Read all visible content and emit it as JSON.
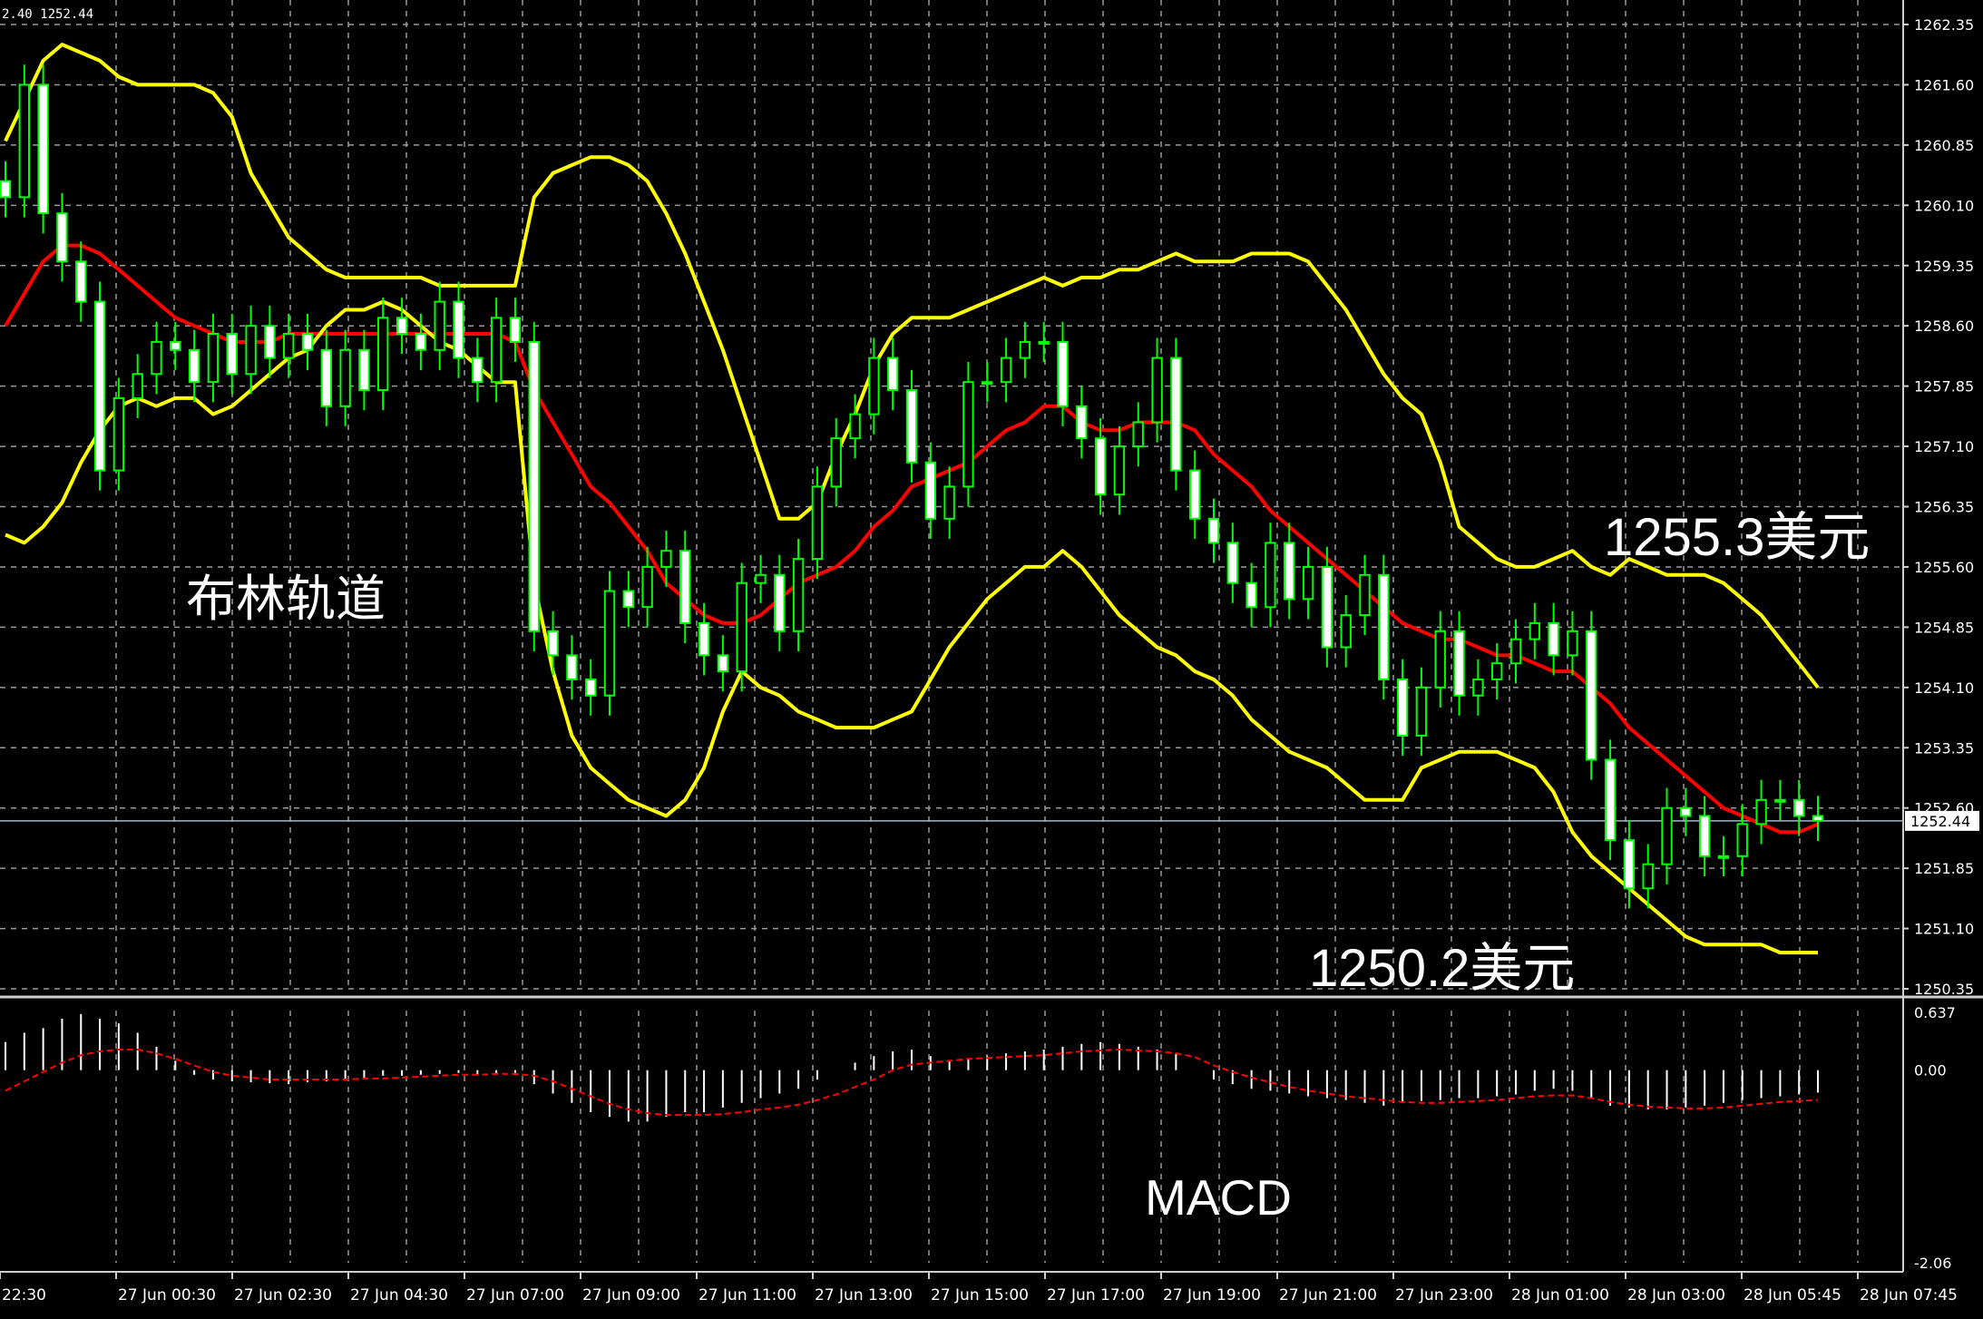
{
  "header": {
    "text": "2.40 1252.44"
  },
  "annotations": {
    "bollinger": "布林轨道",
    "upper_price": "1255.3美元",
    "lower_price": "1250.2美元",
    "macd": "MACD"
  },
  "colors": {
    "background": "#000000",
    "grid": "#9a9a9a",
    "candle": "#00ff00",
    "bollinger_band": "#ffff00",
    "bollinger_middle": "#ff0000",
    "macd_histogram": "#ffffff",
    "macd_signal": "#ff0000",
    "axis_text": "#ffffff"
  },
  "chart_data": [
    {
      "type": "candlestick",
      "panel": "price",
      "indicator": "Bollinger Bands",
      "ylim": [
        1250.35,
        1262.35
      ],
      "y_ticks": [
        "1262.35",
        "1261.60",
        "1260.85",
        "1260.10",
        "1259.35",
        "1258.60",
        "1257.85",
        "1257.10",
        "1256.35",
        "1255.60",
        "1254.85",
        "1254.10",
        "1253.35",
        "1252.60",
        "1251.85",
        "1251.10",
        "1250.35"
      ],
      "current_price": "1252.44",
      "x_ticks": [
        "22:30",
        "27 Jun 00:30",
        "27 Jun 02:30",
        "27 Jun 04:30",
        "27 Jun 07:00",
        "27 Jun 09:00",
        "27 Jun 11:00",
        "27 Jun 13:00",
        "27 Jun 15:00",
        "27 Jun 17:00",
        "27 Jun 19:00",
        "27 Jun 21:00",
        "27 Jun 23:00",
        "28 Jun 01:00",
        "28 Jun 03:00",
        "28 Jun 05:45",
        "28 Jun 07:45"
      ],
      "close": [
        1260.2,
        1261.6,
        1260.0,
        1259.4,
        1258.9,
        1256.8,
        1257.7,
        1258.0,
        1258.4,
        1258.3,
        1257.9,
        1258.5,
        1258.0,
        1258.6,
        1258.2,
        1258.5,
        1258.3,
        1257.6,
        1258.3,
        1257.8,
        1258.7,
        1258.5,
        1258.3,
        1258.9,
        1258.2,
        1257.9,
        1258.7,
        1258.4,
        1254.8,
        1254.5,
        1254.2,
        1254.0,
        1255.3,
        1255.1,
        1255.6,
        1255.8,
        1254.9,
        1254.5,
        1254.3,
        1255.4,
        1255.5,
        1254.8,
        1255.7,
        1256.6,
        1257.2,
        1257.5,
        1258.2,
        1257.8,
        1256.9,
        1256.2,
        1256.6,
        1257.9,
        1257.9,
        1258.2,
        1258.4,
        1258.4,
        1257.6,
        1257.2,
        1256.5,
        1257.1,
        1257.4,
        1258.2,
        1256.8,
        1256.2,
        1255.9,
        1255.4,
        1255.1,
        1255.9,
        1255.2,
        1255.6,
        1254.6,
        1255.0,
        1255.5,
        1254.2,
        1253.5,
        1254.1,
        1254.8,
        1254.0,
        1254.2,
        1254.4,
        1254.7,
        1254.9,
        1254.5,
        1254.8,
        1253.2,
        1252.2,
        1251.6,
        1251.9,
        1252.6,
        1252.5,
        1252.0,
        1252.0,
        1252.4,
        1252.7,
        1252.7,
        1252.5,
        1252.44
      ],
      "series": [
        {
          "name": "upper",
          "values": [
            1260.9,
            1261.4,
            1261.9,
            1262.1,
            1262.0,
            1261.9,
            1261.7,
            1261.6,
            1261.6,
            1261.6,
            1261.6,
            1261.5,
            1261.2,
            1260.5,
            1260.1,
            1259.7,
            1259.5,
            1259.3,
            1259.2,
            1259.2,
            1259.2,
            1259.2,
            1259.2,
            1259.1,
            1259.1,
            1259.1,
            1259.1,
            1259.1,
            1260.2,
            1260.5,
            1260.6,
            1260.7,
            1260.7,
            1260.6,
            1260.4,
            1260.0,
            1259.5,
            1258.9,
            1258.3,
            1257.6,
            1256.9,
            1256.2,
            1256.2,
            1256.4,
            1257.0,
            1257.5,
            1258.1,
            1258.5,
            1258.7,
            1258.7,
            1258.7,
            1258.8,
            1258.9,
            1259.0,
            1259.1,
            1259.2,
            1259.1,
            1259.2,
            1259.2,
            1259.3,
            1259.3,
            1259.4,
            1259.5,
            1259.4,
            1259.4,
            1259.4,
            1259.5,
            1259.5,
            1259.5,
            1259.4,
            1259.1,
            1258.8,
            1258.4,
            1258.0,
            1257.7,
            1257.5,
            1256.9,
            1256.1,
            1255.9,
            1255.7,
            1255.6,
            1255.6,
            1255.7,
            1255.8,
            1255.6,
            1255.5,
            1255.7,
            1255.6,
            1255.5,
            1255.5,
            1255.5,
            1255.4,
            1255.2,
            1255.0,
            1254.7,
            1254.4,
            1254.1
          ]
        },
        {
          "name": "middle",
          "values": [
            1258.6,
            1259.0,
            1259.4,
            1259.6,
            1259.6,
            1259.5,
            1259.3,
            1259.1,
            1258.9,
            1258.7,
            1258.6,
            1258.5,
            1258.4,
            1258.4,
            1258.4,
            1258.5,
            1258.5,
            1258.5,
            1258.5,
            1258.5,
            1258.5,
            1258.5,
            1258.5,
            1258.5,
            1258.5,
            1258.5,
            1258.5,
            1258.4,
            1257.8,
            1257.4,
            1257.0,
            1256.6,
            1256.4,
            1256.1,
            1255.8,
            1255.4,
            1255.2,
            1255.0,
            1254.9,
            1254.9,
            1255.0,
            1255.2,
            1255.4,
            1255.5,
            1255.6,
            1255.8,
            1256.1,
            1256.3,
            1256.6,
            1256.7,
            1256.8,
            1256.9,
            1257.1,
            1257.3,
            1257.4,
            1257.6,
            1257.6,
            1257.4,
            1257.3,
            1257.3,
            1257.4,
            1257.4,
            1257.4,
            1257.3,
            1257.0,
            1256.8,
            1256.6,
            1256.3,
            1256.1,
            1255.9,
            1255.7,
            1255.5,
            1255.3,
            1255.1,
            1254.9,
            1254.8,
            1254.7,
            1254.7,
            1254.6,
            1254.5,
            1254.5,
            1254.4,
            1254.3,
            1254.3,
            1254.1,
            1253.9,
            1253.6,
            1253.4,
            1253.2,
            1253.0,
            1252.8,
            1252.6,
            1252.5,
            1252.4,
            1252.3,
            1252.3,
            1252.4
          ]
        },
        {
          "name": "lower",
          "values": [
            1256.0,
            1255.9,
            1256.1,
            1256.4,
            1256.9,
            1257.3,
            1257.6,
            1257.7,
            1257.6,
            1257.7,
            1257.7,
            1257.5,
            1257.6,
            1257.8,
            1258.0,
            1258.2,
            1258.3,
            1258.6,
            1258.8,
            1258.8,
            1258.9,
            1258.8,
            1258.6,
            1258.4,
            1258.3,
            1258.1,
            1257.9,
            1257.9,
            1255.4,
            1254.3,
            1253.5,
            1253.1,
            1252.9,
            1252.7,
            1252.6,
            1252.5,
            1252.7,
            1253.1,
            1253.8,
            1254.3,
            1254.1,
            1254.0,
            1253.8,
            1253.7,
            1253.6,
            1253.6,
            1253.6,
            1253.7,
            1253.8,
            1254.2,
            1254.6,
            1254.9,
            1255.2,
            1255.4,
            1255.6,
            1255.6,
            1255.8,
            1255.6,
            1255.3,
            1255.0,
            1254.8,
            1254.6,
            1254.5,
            1254.3,
            1254.2,
            1254.0,
            1253.7,
            1253.5,
            1253.3,
            1253.2,
            1253.1,
            1252.9,
            1252.7,
            1252.7,
            1252.7,
            1253.1,
            1253.2,
            1253.3,
            1253.3,
            1253.3,
            1253.2,
            1253.1,
            1252.8,
            1252.3,
            1252.0,
            1251.8,
            1251.6,
            1251.4,
            1251.2,
            1251.0,
            1250.9,
            1250.9,
            1250.9,
            1250.9,
            1250.8,
            1250.8,
            1250.8
          ]
        }
      ]
    },
    {
      "type": "bar",
      "panel": "indicator",
      "indicator": "MACD",
      "ylim": [
        -2.06,
        0.637
      ],
      "y_ticks": [
        "0.637",
        "0.00",
        "-2.06"
      ],
      "series": [
        {
          "name": "histogram",
          "values": [
            0.3,
            0.4,
            0.45,
            0.55,
            0.6,
            0.55,
            0.5,
            0.4,
            0.25,
            0.1,
            -0.05,
            -0.1,
            -0.12,
            -0.13,
            -0.14,
            -0.15,
            -0.13,
            -0.12,
            -0.1,
            -0.08,
            -0.06,
            -0.06,
            -0.05,
            -0.04,
            -0.03,
            -0.05,
            -0.04,
            -0.05,
            -0.15,
            -0.25,
            -0.35,
            -0.45,
            -0.5,
            -0.55,
            -0.55,
            -0.5,
            -0.45,
            -0.45,
            -0.4,
            -0.35,
            -0.3,
            -0.25,
            -0.2,
            -0.1,
            0.0,
            0.08,
            0.15,
            0.2,
            0.22,
            0.15,
            0.1,
            0.12,
            0.15,
            0.18,
            0.2,
            0.22,
            0.25,
            0.28,
            0.3,
            0.28,
            0.25,
            0.22,
            0.18,
            0.0,
            -0.1,
            -0.15,
            -0.2,
            -0.22,
            -0.25,
            -0.28,
            -0.3,
            -0.32,
            -0.35,
            -0.38,
            -0.35,
            -0.33,
            -0.32,
            -0.3,
            -0.3,
            -0.28,
            -0.26,
            -0.22,
            -0.2,
            -0.22,
            -0.3,
            -0.38,
            -0.4,
            -0.42,
            -0.42,
            -0.4,
            -0.38,
            -0.35,
            -0.32,
            -0.3,
            -0.28,
            -0.26,
            -0.24
          ]
        },
        {
          "name": "signal",
          "values": [
            -0.22,
            -0.12,
            -0.02,
            0.08,
            0.16,
            0.2,
            0.22,
            0.22,
            0.18,
            0.12,
            0.05,
            -0.02,
            -0.06,
            -0.08,
            -0.1,
            -0.1,
            -0.1,
            -0.1,
            -0.1,
            -0.09,
            -0.09,
            -0.08,
            -0.07,
            -0.06,
            -0.05,
            -0.05,
            -0.04,
            -0.04,
            -0.06,
            -0.12,
            -0.2,
            -0.28,
            -0.36,
            -0.42,
            -0.46,
            -0.48,
            -0.48,
            -0.48,
            -0.47,
            -0.45,
            -0.42,
            -0.4,
            -0.37,
            -0.32,
            -0.26,
            -0.18,
            -0.1,
            0.0,
            0.06,
            0.08,
            0.1,
            0.12,
            0.13,
            0.14,
            0.15,
            0.16,
            0.18,
            0.2,
            0.21,
            0.22,
            0.21,
            0.2,
            0.18,
            0.14,
            0.05,
            -0.02,
            -0.08,
            -0.13,
            -0.18,
            -0.22,
            -0.25,
            -0.28,
            -0.3,
            -0.32,
            -0.34,
            -0.35,
            -0.35,
            -0.34,
            -0.33,
            -0.32,
            -0.3,
            -0.28,
            -0.27,
            -0.27,
            -0.3,
            -0.34,
            -0.37,
            -0.39,
            -0.4,
            -0.41,
            -0.41,
            -0.4,
            -0.38,
            -0.36,
            -0.34,
            -0.33,
            -0.32
          ]
        }
      ]
    }
  ]
}
